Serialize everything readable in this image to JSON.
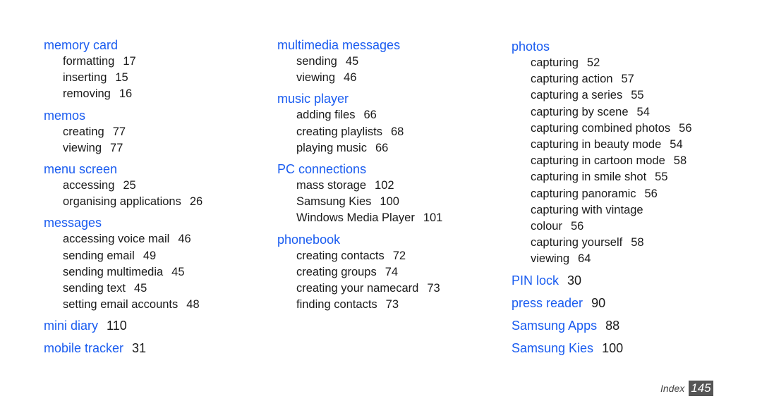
{
  "columns": [
    [
      {
        "term": "memory card",
        "subs": [
          [
            "formatting",
            "17"
          ],
          [
            "inserting",
            "15"
          ],
          [
            "removing",
            "16"
          ]
        ]
      },
      {
        "term": "memos",
        "subs": [
          [
            "creating",
            "77"
          ],
          [
            "viewing",
            "77"
          ]
        ]
      },
      {
        "term": "menu screen",
        "subs": [
          [
            "accessing",
            "25"
          ],
          [
            "organising applications",
            "26"
          ]
        ]
      },
      {
        "term": "messages",
        "subs": [
          [
            "accessing voice mail",
            "46"
          ],
          [
            "sending email",
            "49"
          ],
          [
            "sending multimedia",
            "45"
          ],
          [
            "sending text",
            "45"
          ],
          [
            "setting email accounts",
            "48"
          ]
        ]
      },
      {
        "term": "mini diary",
        "page": "110",
        "subs": []
      },
      {
        "term": "mobile tracker",
        "page": "31",
        "subs": []
      }
    ],
    [
      {
        "term": "multimedia messages",
        "subs": [
          [
            "sending",
            "45"
          ],
          [
            "viewing",
            "46"
          ]
        ]
      },
      {
        "term": "music player",
        "subs": [
          [
            "adding files",
            "66"
          ],
          [
            "creating playlists",
            "68"
          ],
          [
            "playing music",
            "66"
          ]
        ]
      },
      {
        "term": "PC connections",
        "subs": [
          [
            "mass storage",
            "102"
          ],
          [
            "Samsung Kies",
            "100"
          ],
          [
            "Windows Media Player",
            "101"
          ]
        ]
      },
      {
        "term": "phonebook",
        "subs": [
          [
            "creating contacts",
            "72"
          ],
          [
            "creating groups",
            "74"
          ],
          [
            "creating your namecard",
            "73"
          ],
          [
            "finding contacts",
            "73"
          ]
        ]
      }
    ],
    [
      {
        "term": "photos",
        "subs": [
          [
            "capturing",
            "52"
          ],
          [
            "capturing action",
            "57"
          ],
          [
            "capturing a series",
            "55"
          ],
          [
            "capturing by scene",
            "54"
          ],
          [
            "capturing combined photos",
            "56"
          ],
          [
            "capturing in beauty mode",
            "54"
          ],
          [
            "capturing in cartoon mode",
            "58"
          ],
          [
            "capturing in smile shot",
            "55"
          ],
          [
            "capturing panoramic",
            "56"
          ],
          [
            "capturing with vintage",
            ""
          ],
          [
            "colour",
            "56"
          ],
          [
            "capturing yourself",
            "58"
          ],
          [
            "viewing",
            "64"
          ]
        ]
      },
      {
        "term": "PIN lock",
        "page": "30",
        "subs": []
      },
      {
        "term": "press reader",
        "page": "90",
        "subs": []
      },
      {
        "term": "Samsung Apps",
        "page": "88",
        "subs": []
      },
      {
        "term": "Samsung Kies",
        "page": "100",
        "subs": []
      }
    ]
  ],
  "footer": {
    "label": "Index",
    "page": "145"
  }
}
